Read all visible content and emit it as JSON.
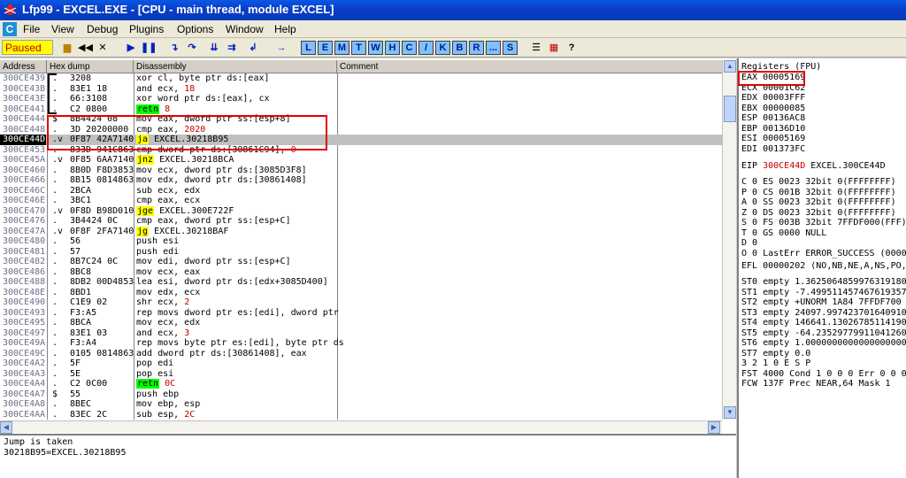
{
  "window": {
    "title": "Lfp99 - EXCEL.EXE - [CPU - main thread, module EXCEL]"
  },
  "menu": {
    "items": [
      "File",
      "View",
      "Debug",
      "Plugins",
      "Options",
      "Window",
      "Help"
    ]
  },
  "toolbar": {
    "status": "Paused",
    "letter_buttons": [
      "L",
      "E",
      "M",
      "T",
      "W",
      "H",
      "C",
      "/",
      "K",
      "B",
      "R",
      "...",
      "S"
    ]
  },
  "disasm": {
    "columns": [
      "Address",
      "Hex dump",
      "Disassembly",
      "Comment"
    ],
    "rows": [
      {
        "addr": "300CE439",
        "mk": ".",
        "hex": "3208",
        "dis": "xor cl, byte ptr ds:[eax]"
      },
      {
        "addr": "300CE43B",
        "mk": ".",
        "hex": "83E1 18",
        "dis": "and ecx, ",
        "num": "18"
      },
      {
        "addr": "300CE43E",
        "mk": ".",
        "hex": "66:3108",
        "dis": "xor word ptr ds:[eax], cx"
      },
      {
        "addr": "300CE441",
        "mk": ".",
        "hex": "C2 0800",
        "kw": "retn",
        "kwtype": "ret",
        "num": "8"
      },
      {
        "addr": "300CE444",
        "mk": "$",
        "hex": "8B4424 08",
        "dis": "mov eax, dword ptr ss:[esp+8]"
      },
      {
        "addr": "300CE448",
        "mk": ".",
        "hex": "3D 20200000",
        "dis": "cmp eax, ",
        "num": "2020"
      },
      {
        "addr": "300CE44D",
        "mk": ".v",
        "hex": "0F87 42A7140",
        "kw": "ja",
        "kwtype": "jmp",
        "dis": " EXCEL.30218B95",
        "current": true
      },
      {
        "addr": "300CE453",
        "mk": ".",
        "hex": "833D 941C863",
        "dis": "cmp dword ptr ds:[30861C94], ",
        "num": "0"
      },
      {
        "addr": "300CE45A",
        "mk": ".v",
        "hex": "0F85 6AA7140",
        "kw": "jnz",
        "kwtype": "jmp",
        "dis": " EXCEL.30218BCA"
      },
      {
        "addr": "300CE460",
        "mk": ".",
        "hex": "8B0D F8D3853",
        "dis": "mov ecx, dword ptr ds:[3085D3F8]"
      },
      {
        "addr": "300CE466",
        "mk": ".",
        "hex": "8B15 0814863",
        "dis": "mov edx, dword ptr ds:[30861408]"
      },
      {
        "addr": "300CE46C",
        "mk": ".",
        "hex": "2BCA",
        "dis": "sub ecx, edx"
      },
      {
        "addr": "300CE46E",
        "mk": ".",
        "hex": "3BC1",
        "dis": "cmp eax, ecx"
      },
      {
        "addr": "300CE470",
        "mk": ".v",
        "hex": "0F8D B98D010",
        "kw": "jge",
        "kwtype": "jmp",
        "dis": " EXCEL.300E722F"
      },
      {
        "addr": "300CE476",
        "mk": ".",
        "hex": "3B4424 0C",
        "dis": "cmp eax, dword ptr ss:[esp+C]"
      },
      {
        "addr": "300CE47A",
        "mk": ".v",
        "hex": "0F8F 2FA7140",
        "kw": "jg",
        "kwtype": "jmp",
        "dis": " EXCEL.30218BAF"
      },
      {
        "addr": "300CE480",
        "mk": ".",
        "hex": "56",
        "dis": "push esi"
      },
      {
        "addr": "300CE481",
        "mk": ".",
        "hex": "57",
        "dis": "push edi"
      },
      {
        "addr": "300CE482",
        "mk": ".",
        "hex": "8B7C24 0C",
        "dis": "mov edi, dword ptr ss:[esp+C]"
      },
      {
        "addr": "300CE486",
        "mk": ".",
        "hex": "8BC8",
        "dis": "mov ecx, eax"
      },
      {
        "addr": "300CE488",
        "mk": ".",
        "hex": "8DB2 00D4853",
        "dis": "lea esi, dword ptr ds:[edx+3085D400]"
      },
      {
        "addr": "300CE48E",
        "mk": ".",
        "hex": "8BD1",
        "dis": "mov edx, ecx"
      },
      {
        "addr": "300CE490",
        "mk": ".",
        "hex": "C1E9 02",
        "dis": "shr ecx, ",
        "num": "2"
      },
      {
        "addr": "300CE493",
        "mk": ".",
        "hex": "F3:A5",
        "dis": "rep movs dword ptr es:[edi], dword ptr"
      },
      {
        "addr": "300CE495",
        "mk": ".",
        "hex": "8BCA",
        "dis": "mov ecx, edx"
      },
      {
        "addr": "300CE497",
        "mk": ".",
        "hex": "83E1 03",
        "dis": "and ecx, ",
        "num": "3"
      },
      {
        "addr": "300CE49A",
        "mk": ".",
        "hex": "F3:A4",
        "dis": "rep movs byte ptr es:[edi], byte ptr ds"
      },
      {
        "addr": "300CE49C",
        "mk": ".",
        "hex": "0105 0814863",
        "dis": "add dword ptr ds:[30861408], eax"
      },
      {
        "addr": "300CE4A2",
        "mk": ".",
        "hex": "5F",
        "dis": "pop edi"
      },
      {
        "addr": "300CE4A3",
        "mk": ".",
        "hex": "5E",
        "dis": "pop esi"
      },
      {
        "addr": "300CE4A4",
        "mk": ".",
        "hex": "C2 0C00",
        "kw": "retn",
        "kwtype": "ret",
        "num": "0C"
      },
      {
        "addr": "300CE4A7",
        "mk": "$",
        "hex": "55",
        "dis": "push ebp"
      },
      {
        "addr": "300CE4A8",
        "mk": ".",
        "hex": "8BEC",
        "dis": "mov ebp, esp"
      },
      {
        "addr": "300CE4AA",
        "mk": ".",
        "hex": "83EC 2C",
        "dis": "sub esp, ",
        "num": "2C"
      }
    ]
  },
  "info": {
    "line1": "Jump is taken",
    "line2": "30218B95=EXCEL.30218B95"
  },
  "registers": {
    "header": "Registers (FPU)",
    "gp": [
      {
        "name": "EAX",
        "value": "00005169"
      },
      {
        "name": "ECX",
        "value": "00001C62"
      },
      {
        "name": "EDX",
        "value": "00003FFF"
      },
      {
        "name": "EBX",
        "value": "00000085"
      },
      {
        "name": "ESP",
        "value": "00136AC8"
      },
      {
        "name": "EBP",
        "value": "00136D10"
      },
      {
        "name": "ESI",
        "value": "00005169"
      },
      {
        "name": "EDI",
        "value": "001373FC"
      }
    ],
    "eip": {
      "name": "EIP",
      "value": "300CE44D",
      "comment": "EXCEL.300CE44D"
    },
    "flags": [
      "C 0  ES 0023 32bit 0(FFFFFFFF)",
      "P 0  CS 001B 32bit 0(FFFFFFFF)",
      "A 0  SS 0023 32bit 0(FFFFFFFF)",
      "Z 0  DS 0023 32bit 0(FFFFFFFF)",
      "S 0  FS 003B 32bit 7FFDF000(FFF)",
      "T 0  GS 0000 NULL",
      "D 0",
      "O 0  LastErr ERROR_SUCCESS (00000"
    ],
    "efl": "EFL 00000202 (NO,NB,NE,A,NS,PO,GE",
    "fpu": [
      "ST0 empty 1.3625064859976319180e-",
      "ST1 empty -7.4995114574676193570e",
      "ST2 empty +UNORM 1A84 7FFDF700 AD",
      "ST3 empty 24097.997423701640910",
      "ST4 empty 146641.13026785114190",
      "ST5 empty -64.235297799110412600",
      "ST6 empty 1.0000000000000000000",
      "ST7 empty 0.0"
    ],
    "fst_hdr": "              3 2 1 0      E S P",
    "fst": "FST 4000  Cond 1 0 0 0  Err 0 0 0",
    "fcw": "FCW 137F  Prec NEAR,64  Mask    1"
  }
}
